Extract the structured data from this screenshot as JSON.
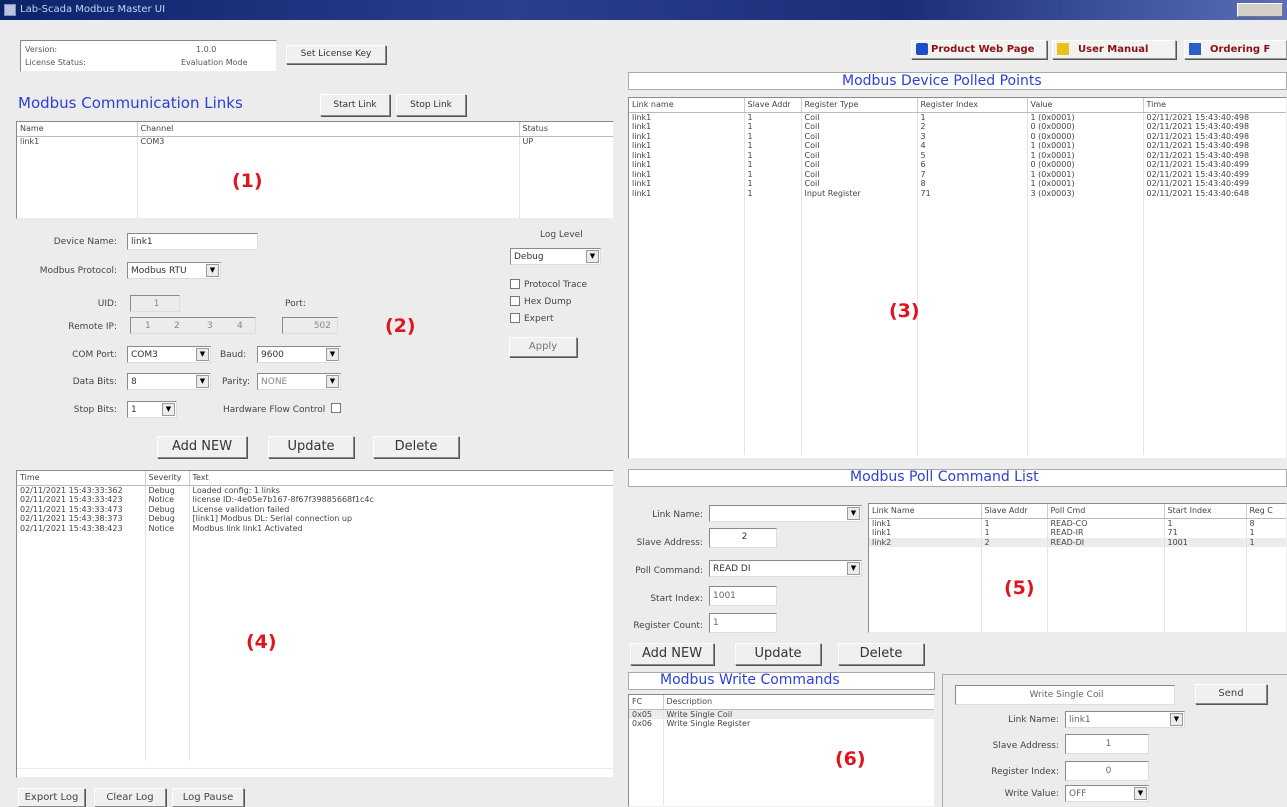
{
  "window": {
    "title": "Lab-Scada Modbus Master UI"
  },
  "version_info": {
    "version_label": "Version:",
    "version_value": "1.0.0",
    "license_label": "License Status:",
    "license_value": "Evaluation Mode"
  },
  "toolbar": {
    "set_license": "Set License Key",
    "product_web": "Product Web Page",
    "user_manual": "User Manual",
    "ordering": "Ordering F"
  },
  "links": {
    "title": "Modbus Communication Links",
    "start": "Start Link",
    "stop": "Stop Link",
    "columns": [
      "Name",
      "Channel",
      "Status"
    ],
    "rows": [
      [
        "link1",
        "COM3",
        "UP"
      ]
    ]
  },
  "markers": [
    "(1)",
    "(2)",
    "(3)",
    "(4)",
    "(5)",
    "(6)"
  ],
  "device": {
    "device_name_label": "Device Name:",
    "device_name": "link1",
    "protocol_label": "Modbus Protocol:",
    "protocol": "Modbus RTU",
    "uid_label": "UID:",
    "uid": "1",
    "port_label": "Port:",
    "port": "502",
    "remote_ip_label": "Remote IP:",
    "ip": [
      "1",
      "2",
      "3",
      "4"
    ],
    "com_port_label": "COM Port:",
    "com_port": "COM3",
    "baud_label": "Baud:",
    "baud": "9600",
    "data_bits_label": "Data Bits:",
    "data_bits": "8",
    "parity_label": "Parity:",
    "parity": "NONE",
    "stop_bits_label": "Stop Bits:",
    "stop_bits": "1",
    "hw_flow_label": "Hardware Flow Control",
    "log_level_label": "Log Level",
    "log_level": "Debug",
    "protocol_trace": "Protocol Trace",
    "hex_dump": "Hex Dump",
    "expert": "Expert",
    "apply": "Apply",
    "add_new": "Add NEW",
    "update": "Update",
    "delete": "Delete"
  },
  "log": {
    "columns": [
      "Time",
      "Severity",
      "Text"
    ],
    "rows": [
      [
        "02/11/2021 15:43:33:362",
        "Debug",
        "Loaded config: 1 links"
      ],
      [
        "02/11/2021 15:43:33:423",
        "Notice",
        "license ID:-4e05e7b167-8f67f39885668f1c4c"
      ],
      [
        "02/11/2021 15:43:33:473",
        "Debug",
        "License validation failed"
      ],
      [
        "02/11/2021 15:43:38:373",
        "Debug",
        "[link1] Modbus DL: Serial connection up"
      ],
      [
        "02/11/2021 15:43:38:423",
        "Notice",
        "Modbus link link1 Activated"
      ]
    ],
    "export": "Export Log",
    "clear": "Clear Log",
    "pause": "Log Pause"
  },
  "polled": {
    "title": "Modbus Device Polled Points",
    "columns": [
      "Link name",
      "Slave Addr",
      "Register Type",
      "Register Index",
      "Value",
      "Time"
    ],
    "rows": [
      [
        "link1",
        "1",
        "Coil",
        "1",
        "1 (0x0001)",
        "02/11/2021 15:43:40:498"
      ],
      [
        "link1",
        "1",
        "Coil",
        "2",
        "0 (0x0000)",
        "02/11/2021 15:43:40:498"
      ],
      [
        "link1",
        "1",
        "Coil",
        "3",
        "0 (0x0000)",
        "02/11/2021 15:43:40:498"
      ],
      [
        "link1",
        "1",
        "Coil",
        "4",
        "1 (0x0001)",
        "02/11/2021 15:43:40:498"
      ],
      [
        "link1",
        "1",
        "Coil",
        "5",
        "1 (0x0001)",
        "02/11/2021 15:43:40:498"
      ],
      [
        "link1",
        "1",
        "Coil",
        "6",
        "0 (0x0000)",
        "02/11/2021 15:43:40:499"
      ],
      [
        "link1",
        "1",
        "Coil",
        "7",
        "1 (0x0001)",
        "02/11/2021 15:43:40:499"
      ],
      [
        "link1",
        "1",
        "Coil",
        "8",
        "1 (0x0001)",
        "02/11/2021 15:43:40:499"
      ],
      [
        "link1",
        "1",
        "Input Register",
        "71",
        "3 (0x0003)",
        "02/11/2021 15:43:40:648"
      ]
    ]
  },
  "poll_cmd": {
    "title": "Modbus Poll Command List",
    "link_name_label": "Link Name:",
    "link_name": "",
    "slave_label": "Slave Address:",
    "slave": "2",
    "poll_command_label": "Poll Command:",
    "poll_command": "READ DI",
    "start_index_label": "Start Index:",
    "start_index": "1001",
    "reg_count_label": "Register Count:",
    "reg_count": "1",
    "columns": [
      "Link Name",
      "Slave Addr",
      "Poll Cmd",
      "Start Index",
      "Reg C"
    ],
    "rows": [
      [
        "link1",
        "1",
        "READ-CO",
        "1",
        "8"
      ],
      [
        "link1",
        "1",
        "READ-IR",
        "71",
        "1"
      ],
      [
        "link2",
        "2",
        "READ-DI",
        "1001",
        "1"
      ]
    ],
    "add_new": "Add NEW",
    "update": "Update",
    "delete": "Delete"
  },
  "write": {
    "title": "Modbus Write Commands",
    "columns": [
      "FC",
      "Description"
    ],
    "rows": [
      [
        "0x05",
        "Write Single Coil"
      ],
      [
        "0x06",
        "Write Single Register"
      ]
    ],
    "selected_cmd": "Write Single Coil",
    "send": "Send",
    "link_name_label": "Link Name:",
    "link_name": "link1",
    "slave_label": "Slave Address:",
    "slave": "1",
    "reg_index_label": "Register Index:",
    "reg_index": "0",
    "write_value_label": "Write Value:",
    "write_value": "OFF"
  }
}
